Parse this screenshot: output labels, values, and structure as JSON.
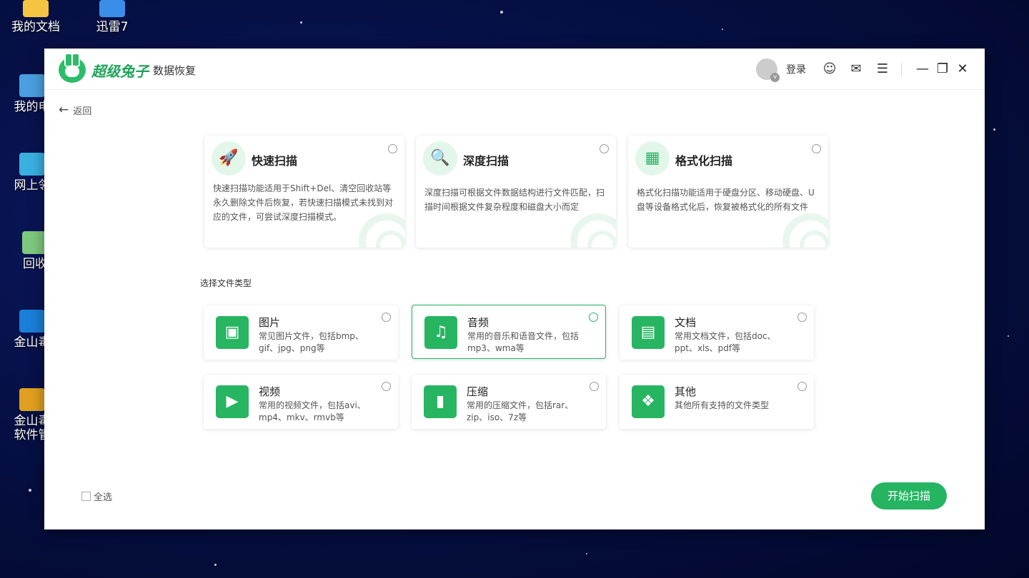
{
  "desktop": {
    "icons": [
      {
        "label": "我的文档",
        "icon": "documents-folder-icon"
      },
      {
        "label": "迅雷7",
        "icon": "xunlei-icon"
      },
      {
        "label": "我的电",
        "icon": "computer-icon"
      },
      {
        "label": "网上邻",
        "icon": "network-icon"
      },
      {
        "label": "回收",
        "icon": "recycle-bin-icon"
      },
      {
        "label": "金山毒",
        "icon": "kingsoft-icon"
      },
      {
        "label": "金山毒",
        "label2": "软件管",
        "icon": "kingsoft-manager-icon"
      }
    ]
  },
  "app": {
    "brand": "超级兔子",
    "product": "数据恢复",
    "login_label": "登录",
    "back_label": "返回"
  },
  "scan_modes": [
    {
      "title": "快速扫描",
      "icon": "rocket-icon",
      "desc": "快速扫描功能适用于Shift+Del、清空回收站等永久删除文件后恢复，若快速扫描模式未找到对应的文件，可尝试深度扫描模式。"
    },
    {
      "title": "深度扫描",
      "icon": "magnifier-icon",
      "desc": "深度扫描可根据文件数据结构进行文件匹配，扫描时间根据文件复杂程度和磁盘大小而定"
    },
    {
      "title": "格式化扫描",
      "icon": "calendar-code-icon",
      "desc": "格式化扫描功能适用于硬盘分区、移动硬盘、U盘等设备格式化后，恢复被格式化的所有文件"
    }
  ],
  "file_types_label": "选择文件类型",
  "file_types": [
    {
      "name": "图片",
      "icon": "image-icon",
      "desc": "常见图片文件，包括bmp、gif、jpg、png等",
      "selected": false
    },
    {
      "name": "音频",
      "icon": "music-icon",
      "desc": "常用的音乐和语音文件，包括mp3、wma等",
      "selected": true
    },
    {
      "name": "文档",
      "icon": "document-icon",
      "desc": "常用文档文件，包括doc、ppt、xls、pdf等",
      "selected": false
    },
    {
      "name": "视频",
      "icon": "video-icon",
      "desc": "常用的视频文件，包括avi、mp4、mkv、rmvb等",
      "selected": false
    },
    {
      "name": "压缩",
      "icon": "zip-icon",
      "desc": "常用的压缩文件，包括rar、zip、iso、7z等",
      "selected": false
    },
    {
      "name": "其他",
      "icon": "grid-icon",
      "desc": "其他所有支持的文件类型",
      "selected": false
    }
  ],
  "footer": {
    "select_all_label": "全选",
    "start_label": "开始扫描"
  },
  "colors": {
    "accent": "#25b461"
  }
}
